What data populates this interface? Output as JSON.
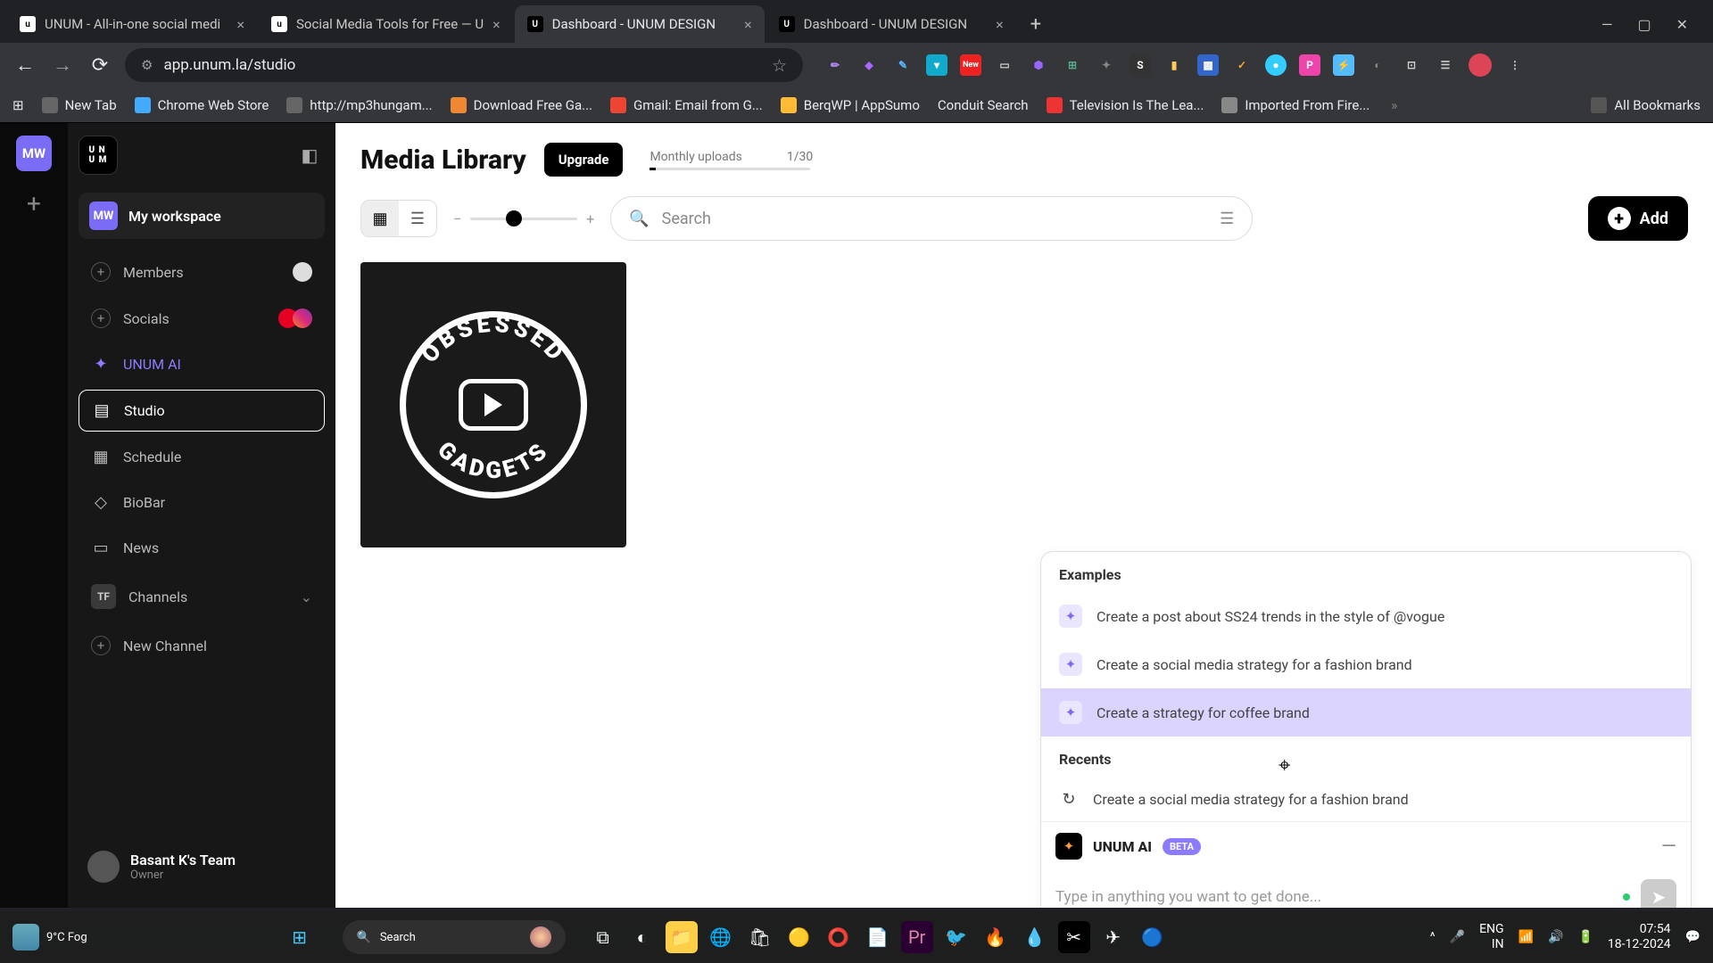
{
  "browser": {
    "tabs": [
      {
        "title": "UNUM - All-in-one social medi"
      },
      {
        "title": "Social Media Tools for Free — U"
      },
      {
        "title": "Dashboard - UNUM DESIGN"
      },
      {
        "title": "Dashboard - UNUM DESIGN"
      }
    ],
    "url": "app.unum.la/studio",
    "bookmarks": [
      {
        "label": "New Tab"
      },
      {
        "label": "Chrome Web Store"
      },
      {
        "label": "http://mp3hungam..."
      },
      {
        "label": "Download Free Ga..."
      },
      {
        "label": "Gmail: Email from G..."
      },
      {
        "label": "BerqWP | AppSumo"
      },
      {
        "label": "Conduit Search"
      },
      {
        "label": "Television Is The Lea..."
      },
      {
        "label": "Imported From Fire..."
      }
    ],
    "all_bookmarks": "All Bookmarks"
  },
  "sidebar": {
    "rail_badge": "MW",
    "workspace_badge": "MW",
    "workspace": "My workspace",
    "members": "Members",
    "socials": "Socials",
    "ai": "UNUM AI",
    "studio": "Studio",
    "schedule": "Schedule",
    "biobar": "BioBar",
    "news": "News",
    "channels_badge": "TF",
    "channels": "Channels",
    "new_channel": "New Channel",
    "team_name": "Basant K's Team",
    "team_role": "Owner"
  },
  "main": {
    "title": "Media Library",
    "upgrade": "Upgrade",
    "uploads_label": "Monthly uploads",
    "uploads_count": "1/30",
    "search_placeholder": "Search",
    "add": "Add",
    "tile_text_top": "OBSESSED",
    "tile_text_bottom": "GADGETS"
  },
  "ai_panel": {
    "examples_title": "Examples",
    "examples": [
      "Create a post about SS24 trends in the style of @vogue",
      "Create a social media strategy for a fashion brand",
      "Create a strategy for coffee brand"
    ],
    "recents_title": "Recents",
    "recents": [
      "Create a social media strategy for a fashion brand"
    ],
    "label": "UNUM AI",
    "beta": "BETA",
    "placeholder": "Type in anything you want to get done..."
  },
  "taskbar": {
    "temp": "9°C",
    "cond": "Fog",
    "search": "Search",
    "lang": "ENG",
    "region": "IN",
    "time": "07:54",
    "date": "18-12-2024"
  }
}
